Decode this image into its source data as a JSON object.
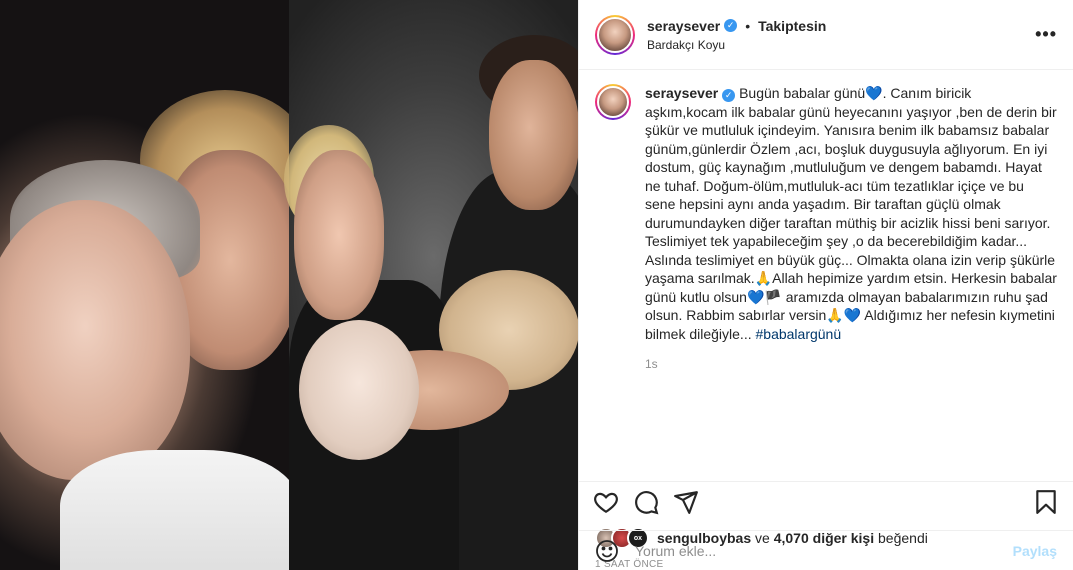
{
  "header": {
    "username": "seraysever",
    "separator": "•",
    "follow_label": "Takiptesin",
    "location": "Bardakçı Koyu",
    "more_label": "•••"
  },
  "caption": {
    "username": "seraysever",
    "text": "Bugün babalar günü💙. Canım biricik aşkım,kocam ilk babalar günü heyecanını yaşıyor ,ben de derin bir şükür ve mutluluk içindeyim. Yanısıra benim ilk babamsız babalar günüm,günlerdir Özlem ,acı, boşluk duygusuyla ağlıyorum. En iyi dostum, güç kaynağım ,mutluluğum ve dengem babamdı. Hayat ne tuhaf. Doğum-ölüm,mutluluk-acı tüm tezatlıklar içiçe ve bu sene hepsini aynı anda yaşadım. Bir taraftan güçlü olmak durumundayken diğer taraftan müthiş bir acizlik hissi beni sarıyor. Teslimiyet tek yapabileceğim şey ,o da becerebildiğim kadar... Aslında teslimiyet en büyük güç... Olmakta olana izin verip şükürle yaşama sarılmak.🙏Allah hepimize yardım etsin. Herkesin babalar günü kutlu olsun💙🏴 aramızda olmayan babalarımızın ruhu şad olsun. Rabbim sabırlar versin🙏💙 Aldığımız her nefesin kıymetini bilmek dileğiyle...",
    "hashtag": "#babalargünü",
    "time": "1s"
  },
  "likes": {
    "mini_badge": "ox",
    "user": "sengulboybas",
    "connector": "ve",
    "count_text": "4,070 diğer kişi",
    "suffix": "beğendi"
  },
  "ago": "1 SAAT ÖNCE",
  "comment": {
    "placeholder": "Yorum ekle...",
    "share_label": "Paylaş"
  },
  "colors": {
    "accent": "#3897f0",
    "share": "#b2dffc",
    "hashtag": "#00376b"
  }
}
